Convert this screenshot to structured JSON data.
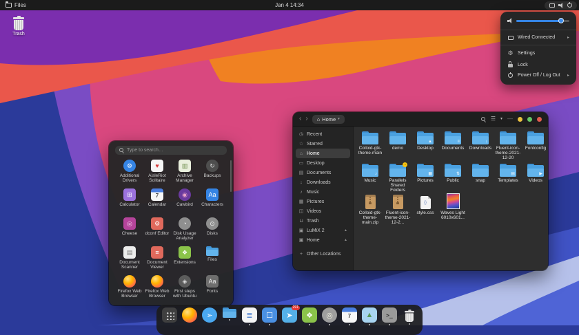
{
  "icons": {
    "back": "‹",
    "forward": "›",
    "home": "⌂",
    "caret": "▾",
    "hamburger": "☰",
    "chevron_down": "▾",
    "minimize": "—",
    "submenu_arrow": "▸"
  },
  "colors": {
    "accent": "#3584e4",
    "window_dots": [
      "#eac13f",
      "#67c767",
      "#e15b4e"
    ],
    "folder": "#4aa0df"
  },
  "topbar": {
    "app_menu": "Files",
    "clock": "Jan 4 14:34"
  },
  "desktop": {
    "trash_label": "Trash"
  },
  "system_menu": {
    "volume_percent": 85,
    "items": [
      {
        "icon": "network",
        "label": "Wired Connected",
        "submenu": true
      },
      {
        "icon": "settings",
        "label": "Settings",
        "submenu": false
      },
      {
        "icon": "lock",
        "label": "Lock",
        "submenu": false
      },
      {
        "icon": "power",
        "label": "Power Off / Log Out",
        "submenu": true
      }
    ]
  },
  "app_grid": {
    "search_placeholder": "Type to search…",
    "apps": [
      {
        "label": "Additional Drivers",
        "glyph": "⚙",
        "bg": "#3584e4",
        "shape": "circle",
        "fg": "#ffffff"
      },
      {
        "label": "AisleRiot Solitaire",
        "glyph": "♥",
        "bg": "#f5f5f5",
        "shape": "square",
        "fg": "#d43a3a"
      },
      {
        "label": "Archive Manager",
        "glyph": "▥",
        "bg": "#e9efdc",
        "shape": "square",
        "fg": "#6f8f4e"
      },
      {
        "label": "Backups",
        "glyph": "↻",
        "bg": "#4e4e4e",
        "shape": "circle",
        "fg": "#dddddd"
      },
      {
        "label": "Calculator",
        "glyph": "⊞",
        "bg": "#9b72dd",
        "shape": "square",
        "fg": "#ffffff"
      },
      {
        "label": "Calendar",
        "glyph": "7",
        "type": "calendar",
        "shape": "square"
      },
      {
        "label": "Cawbird",
        "glyph": "◉",
        "bg": "#6a3a9e",
        "shape": "circle",
        "fg": "#e8a0c8"
      },
      {
        "label": "Characters",
        "glyph": "Aa",
        "bg": "#3584e4",
        "shape": "square",
        "fg": "#ffffff"
      },
      {
        "label": "Cheese",
        "glyph": "◎",
        "bg": "#b5449b",
        "shape": "square",
        "fg": "#f8d8f0"
      },
      {
        "label": "dconf Editor",
        "glyph": "⚙",
        "bg": "#e0695c",
        "shape": "square",
        "fg": "#ffffff"
      },
      {
        "label": "Disk Usage Analyzer",
        "glyph": "◔",
        "bg": "#8f8f8f",
        "shape": "circle",
        "fg": "#eeeeee"
      },
      {
        "label": "Disks",
        "glyph": "⊙",
        "bg": "#8f8f8f",
        "shape": "circle",
        "fg": "#eeeeee"
      },
      {
        "label": "Document Scanner",
        "glyph": "▤",
        "bg": "#ececec",
        "shape": "square",
        "fg": "#777777"
      },
      {
        "label": "Document Viewer",
        "glyph": "≡",
        "bg": "#e0695c",
        "shape": "square",
        "fg": "#ffffff"
      },
      {
        "label": "Extensions",
        "glyph": "❖",
        "bg": "#8bc34a",
        "shape": "square",
        "fg": "#ffffff"
      },
      {
        "label": "Files",
        "type": "folder"
      },
      {
        "label": "Firefox Web Browser",
        "type": "firefox"
      },
      {
        "label": "Firefox Web Browser",
        "type": "firefox"
      },
      {
        "label": "First steps with Ubuntu",
        "glyph": "◈",
        "bg": "#5c5c5c",
        "shape": "circle",
        "fg": "#dddddd"
      },
      {
        "label": "Fonts",
        "glyph": "Aa",
        "bg": "#6e6e6e",
        "shape": "square",
        "fg": "#eeeeee"
      }
    ]
  },
  "files_window": {
    "path_button": {
      "label": "Home"
    },
    "sidebar": [
      {
        "icon": "◷",
        "label": "Recent"
      },
      {
        "icon": "☆",
        "label": "Starred"
      },
      {
        "icon": "⌂",
        "label": "Home",
        "selected": true
      },
      {
        "icon": "▭",
        "label": "Desktop"
      },
      {
        "icon": "▤",
        "label": "Documents"
      },
      {
        "icon": "↓",
        "label": "Downloads"
      },
      {
        "icon": "♪",
        "label": "Music"
      },
      {
        "icon": "▦",
        "label": "Pictures"
      },
      {
        "icon": "◫",
        "label": "Videos"
      },
      {
        "icon": "⊔",
        "label": "Trash"
      },
      {
        "icon": "▣",
        "label": "LuMiX 2",
        "eject": true
      },
      {
        "icon": "▣",
        "label": "Home",
        "eject": true
      },
      {
        "icon": "+",
        "label": "Other Locations",
        "other": true
      }
    ],
    "files": [
      {
        "name": "Colloid-gtk-theme-main",
        "type": "folder"
      },
      {
        "name": "demo",
        "type": "folder"
      },
      {
        "name": "Desktop",
        "type": "folder",
        "emblem": "▲"
      },
      {
        "name": "Documents",
        "type": "folder",
        "emblem": "≡"
      },
      {
        "name": "Downloads",
        "type": "folder",
        "emblem": "↓"
      },
      {
        "name": "Fluent-icon-theme-2021-12-20",
        "type": "folder"
      },
      {
        "name": "Fontconfig",
        "type": "folder"
      },
      {
        "name": "Music",
        "type": "folder",
        "emblem": "♪"
      },
      {
        "name": "Parallels Shared Folders",
        "type": "folder",
        "badge": "→"
      },
      {
        "name": "Pictures",
        "type": "folder",
        "emblem": "▦"
      },
      {
        "name": "Public",
        "type": "folder",
        "emblem": "⇅"
      },
      {
        "name": "snap",
        "type": "folder"
      },
      {
        "name": "Templates",
        "type": "folder",
        "emblem": "▤"
      },
      {
        "name": "Videos",
        "type": "folder",
        "emblem": "▶"
      },
      {
        "name": "Colloid-gtk-theme-main.zip",
        "type": "zip"
      },
      {
        "name": "Fluent-icon-theme-2021-12-2...",
        "type": "zip"
      },
      {
        "name": "style.css",
        "type": "css",
        "glyph": "{}"
      },
      {
        "name": "Waves Light 6010x601...",
        "type": "image"
      }
    ]
  },
  "dock": {
    "badge": "291",
    "items": [
      {
        "name": "show-apps",
        "type": "dots",
        "active": true
      },
      {
        "name": "firefox",
        "type": "firefox"
      },
      {
        "name": "cawbird",
        "glyph": "➢",
        "bg": "#4aa8f0",
        "shape": "circle",
        "fg": "#ffffff"
      },
      {
        "name": "files",
        "type": "folder",
        "running": true
      },
      {
        "name": "text-editor",
        "glyph": "≣",
        "bg": "#f5f5f5",
        "shape": "square",
        "fg": "#4a7fd0",
        "running": true
      },
      {
        "name": "software",
        "glyph": "☐",
        "bg": "#4a90e2",
        "shape": "square",
        "fg": "#ffffff",
        "running": true
      },
      {
        "name": "messenger",
        "glyph": "➤",
        "bg": "#54b0e8",
        "shape": "square",
        "fg": "#ffffff",
        "badge": "291"
      },
      {
        "name": "extensions",
        "glyph": "❖",
        "bg": "#8bc34a",
        "shape": "square",
        "fg": "#ffffff",
        "running": true
      },
      {
        "name": "tweaks",
        "glyph": "◎",
        "bg": "#9e9e9e",
        "shape": "circle",
        "fg": "#f0f0e0",
        "running": true
      },
      {
        "name": "calendar",
        "glyph": "7",
        "type": "calendar",
        "shape": "square",
        "running": true
      },
      {
        "name": "photos",
        "glyph": "▲",
        "bg": "#a8d4f0",
        "shape": "square",
        "fg": "#5a9a5a",
        "running": true
      },
      {
        "name": "terminal",
        "glyph": ">_",
        "bg": "#9a9a9a",
        "shape": "square",
        "fg": "#2e2e2e",
        "mono": true,
        "running": true
      },
      {
        "name": "trash",
        "type": "trash",
        "running": true
      }
    ]
  }
}
